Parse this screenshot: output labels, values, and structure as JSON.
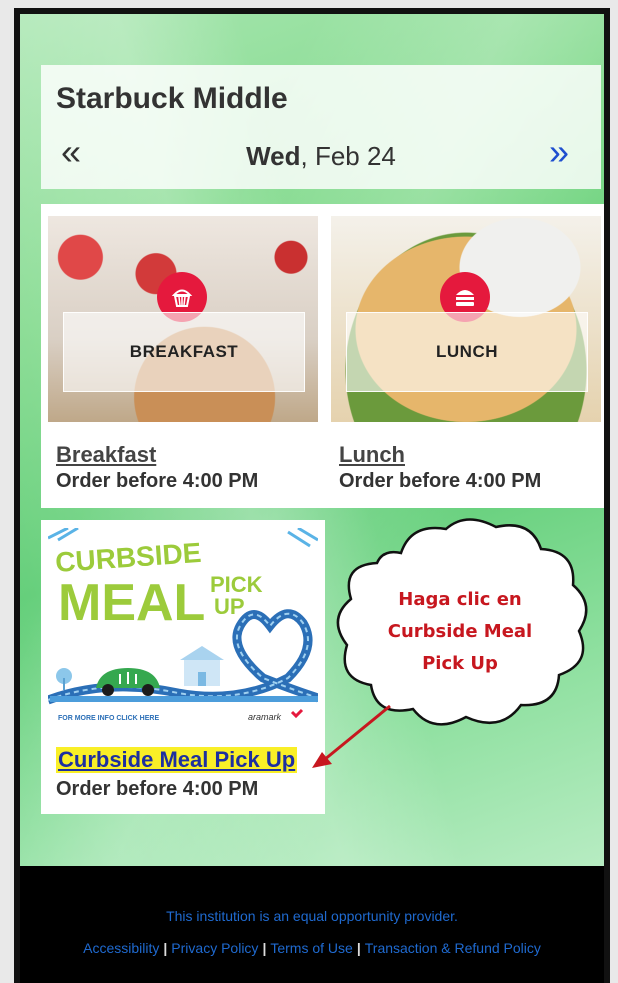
{
  "header": {
    "school": "Starbuck Middle",
    "prev_icon": "«",
    "next_icon": "»",
    "date_weekday": "Wed",
    "date_rest": ", Feb 24"
  },
  "menus": [
    {
      "banner": "BREAKFAST",
      "link": "Breakfast",
      "subtitle": "Order before 4:00 PM",
      "icon": "cupcake-icon"
    },
    {
      "banner": "LUNCH",
      "link": "Lunch",
      "subtitle": "Order before 4:00 PM",
      "icon": "burger-icon"
    }
  ],
  "curbside": {
    "image": {
      "line1": "CURBSIDE",
      "line2": "MEAL",
      "line3": "PICK",
      "line4": "UP",
      "info": "FOR MORE INFO CLICK HERE",
      "brand": "aramark"
    },
    "link": "Curbside Meal Pick Up",
    "subtitle": "Order before 4:00 PM"
  },
  "callout": {
    "line1": "Haga clic en",
    "line2": "Curbside Meal",
    "line3": "Pick Up"
  },
  "footer": {
    "note": "This institution is an equal opportunity provider.",
    "links": [
      "Accessibility",
      "Privacy Policy",
      "Terms of Use",
      "Transaction & Refund Policy"
    ],
    "separator": "|"
  },
  "colors": {
    "accent_red": "#e5193d",
    "link_blue": "#1d2fa0",
    "highlight_yellow": "#f9ef27",
    "callout_red": "#c7171f"
  }
}
